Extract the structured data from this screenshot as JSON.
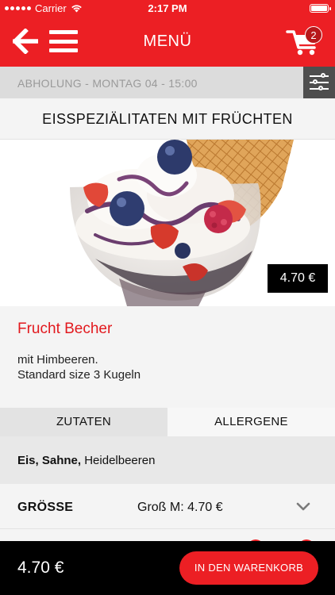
{
  "status_bar": {
    "carrier": "Carrier",
    "time": "2:17 PM",
    "battery_level": 1.0
  },
  "header": {
    "title": "MENÜ",
    "cart_count": "2",
    "back_icon": "back-arrow-icon",
    "menu_icon": "hamburger-icon",
    "cart_icon": "shopping-cart-icon"
  },
  "pickup": {
    "text": "ABHOLUNG - MONTAG 04 - 15:00",
    "filter_icon": "sliders-icon"
  },
  "category": {
    "title": "EISSPEZIÄLITATEN MIT FRÜCHTEN"
  },
  "product": {
    "price_tag": "4.70 €",
    "name": "Frucht Becher",
    "description": [
      "mit Himbeeren.",
      "Standard size 3 Kugeln"
    ]
  },
  "tabs": {
    "ingredients": "ZUTATEN",
    "allergens": "ALLERGENE",
    "active": "ingredients"
  },
  "ingredients": {
    "bold": "Eis, Sahne,",
    "rest": "Heidelbeeren"
  },
  "size": {
    "label": "GRÖSSE",
    "value": "Groß M: 4.70 €",
    "icon": "chevron-down-icon"
  },
  "footer": {
    "total": "4.70 €",
    "add_label": "IN DEN WARENKORB"
  },
  "colors": {
    "brand_red": "#ec1f24",
    "dark": "#000000",
    "filter_bg": "#4e4e4e"
  }
}
